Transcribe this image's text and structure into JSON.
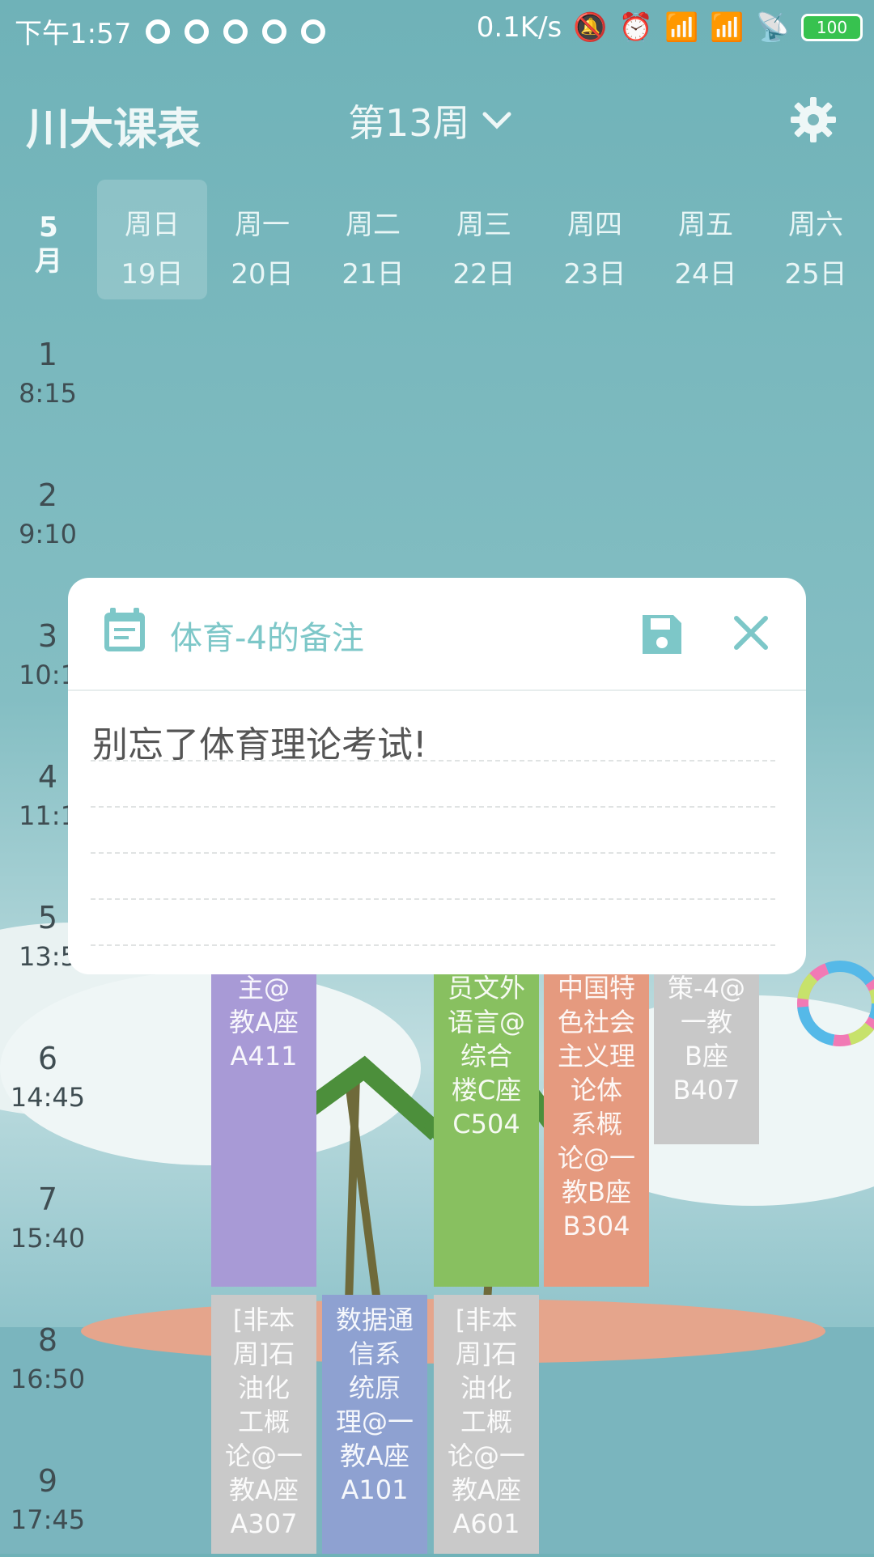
{
  "status_bar": {
    "time": "下午1:57",
    "speed": "0.1K/s",
    "battery": "100"
  },
  "header": {
    "title": "川大课表",
    "week": "第13周"
  },
  "calendar": {
    "month_number": "5",
    "month_char": "月",
    "days": [
      {
        "label": "周日",
        "date": "19日"
      },
      {
        "label": "周一",
        "date": "20日"
      },
      {
        "label": "周二",
        "date": "21日"
      },
      {
        "label": "周三",
        "date": "22日"
      },
      {
        "label": "周四",
        "date": "23日"
      },
      {
        "label": "周五",
        "date": "24日"
      },
      {
        "label": "周六",
        "date": "25日"
      }
    ]
  },
  "periods": [
    {
      "num": "1",
      "time": "8:15"
    },
    {
      "num": "2",
      "time": "9:10"
    },
    {
      "num": "3",
      "time": "10:1"
    },
    {
      "num": "4",
      "time": "11:1"
    },
    {
      "num": "5",
      "time": "13:5"
    },
    {
      "num": "6",
      "time": "14:45"
    },
    {
      "num": "7",
      "time": "15:40"
    },
    {
      "num": "8",
      "time": "16:50"
    },
    {
      "num": "9",
      "time": "17:45"
    }
  ],
  "courses": [
    {
      "text": "主@\n教A座\nA411"
    },
    {
      "text": "员文外\n语言@\n综合\n楼C座\nC504"
    },
    {
      "text": "中国特\n色社会\n主义理\n论体\n系概\n论@一\n教B座\nB304"
    },
    {
      "text": "策-4@\n一教\nB座\nB407"
    },
    {
      "text": "[非本\n周]石\n油化\n工概\n论@一\n教A座\nA307"
    },
    {
      "text": "数据通\n信系\n统原\n理@一\n教A座\nA101"
    },
    {
      "text": "[非本\n周]石\n油化\n工概\n论@一\n教A座\nA601"
    }
  ],
  "dialog": {
    "title": "体育-4的备注",
    "note": "别忘了体育理论考试!"
  },
  "colors": {
    "accent": "#7dc7c8",
    "purple": "#a89ad6",
    "green": "#88c060",
    "orange": "#e59a7f",
    "gray": "#c9c9c9",
    "blue": "#8ea1d1"
  }
}
